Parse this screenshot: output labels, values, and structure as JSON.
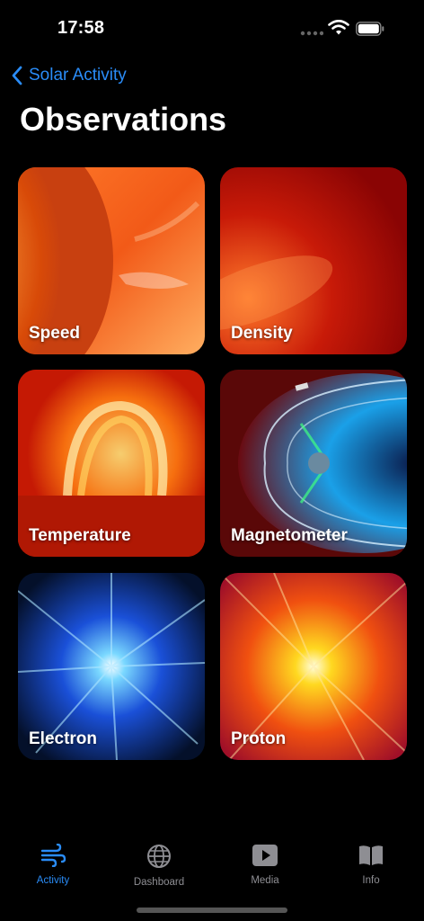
{
  "status": {
    "time": "17:58"
  },
  "nav": {
    "back_label": "Solar Activity"
  },
  "title": "Observations",
  "cards": [
    {
      "label": "Speed"
    },
    {
      "label": "Density"
    },
    {
      "label": "Temperature"
    },
    {
      "label": "Magnetometer"
    },
    {
      "label": "Electron"
    },
    {
      "label": "Proton"
    }
  ],
  "tabs": [
    {
      "label": "Activity",
      "icon": "wind-icon",
      "active": true
    },
    {
      "label": "Dashboard",
      "icon": "globe-icon",
      "active": false
    },
    {
      "label": "Media",
      "icon": "play-icon",
      "active": false
    },
    {
      "label": "Info",
      "icon": "book-icon",
      "active": false
    }
  ],
  "colors": {
    "accent": "#2a8cf7",
    "tab_inactive": "#8e8e93",
    "background": "#000000"
  }
}
